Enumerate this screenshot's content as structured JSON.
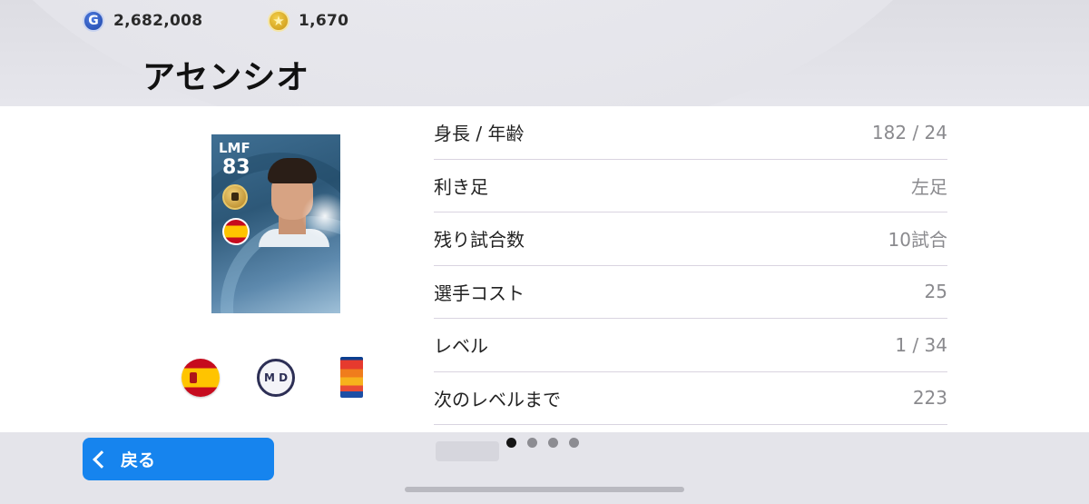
{
  "header": {
    "gp_amount": "2,682,008",
    "coins_amount": "1,670",
    "gp_icon_letter": "G",
    "coin_icon_glyph": "★",
    "player_name": "アセンシオ"
  },
  "card": {
    "position": "LMF",
    "overall": "83"
  },
  "badges": {
    "club_text": "M D"
  },
  "stats": [
    {
      "label": "身長 / 年齢",
      "value": "182 / 24"
    },
    {
      "label": "利き足",
      "value": "左足"
    },
    {
      "label": "残り試合数",
      "value": "10試合"
    },
    {
      "label": "選手コスト",
      "value": "25"
    },
    {
      "label": "レベル",
      "value": "1 / 34"
    },
    {
      "label": "次のレベルまで",
      "value": "223"
    }
  ],
  "pagination": {
    "total": 4,
    "active": 1
  },
  "footer": {
    "back_label": "戻る"
  },
  "colors": {
    "accent_blue": "#1684ee",
    "card_blue": "#3f6f93"
  }
}
